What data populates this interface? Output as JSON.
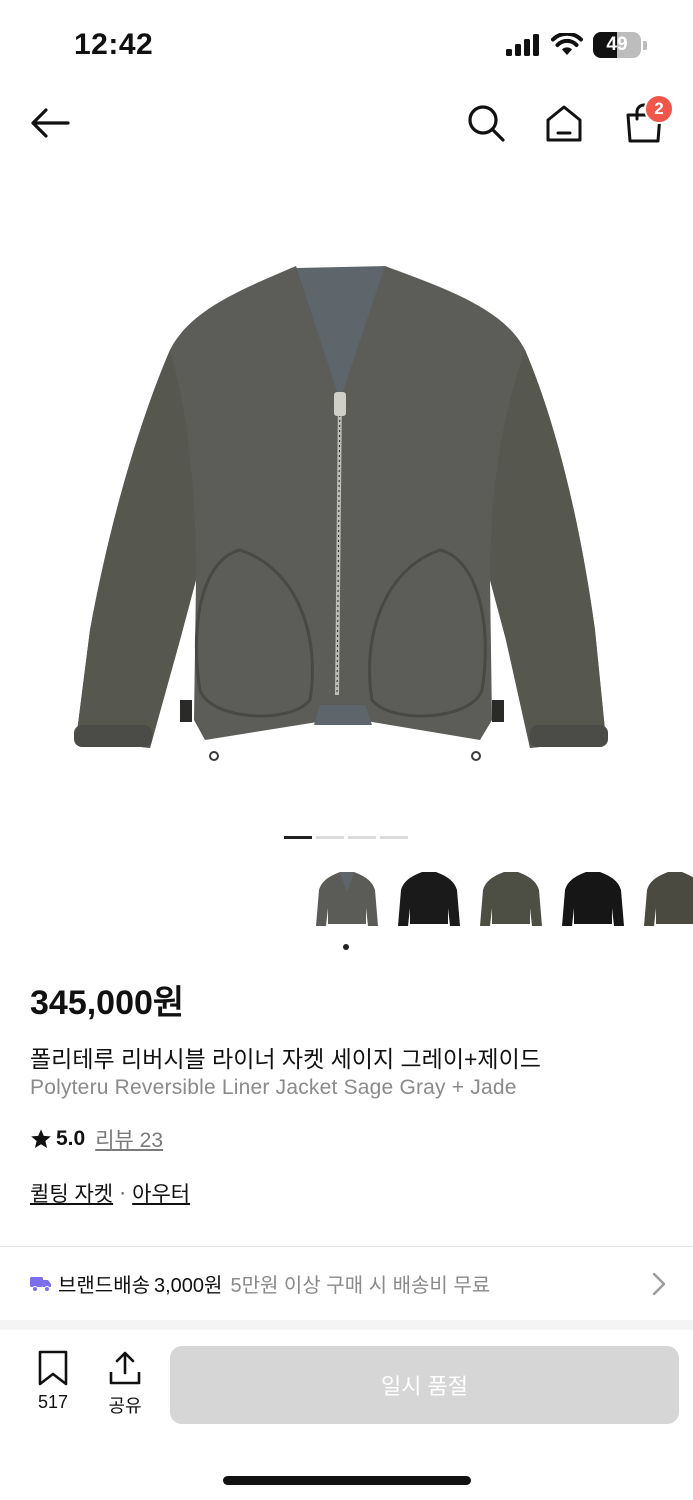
{
  "status_bar": {
    "time": "12:42",
    "battery_text": "49",
    "battery_level": 0.49,
    "icons": [
      "cellular-signal-icon",
      "wifi-icon",
      "battery-icon"
    ]
  },
  "nav": {
    "icons": [
      "back-arrow-icon",
      "search-icon",
      "home-icon",
      "shopping-bag-icon"
    ],
    "cart_count": "2"
  },
  "gallery": {
    "image_count": 4,
    "active_index": 0,
    "thumbnails": [
      {
        "color": "#5b5c58"
      },
      {
        "color": "#1a1a1a"
      },
      {
        "color": "#4e4f44"
      },
      {
        "color": "#161616"
      },
      {
        "color": "#4b4a40"
      }
    ],
    "selected_thumbnail": 0
  },
  "product": {
    "price": "345,000원",
    "title_ko": "폴리테루 리버시블 라이너 자켓 세이지 그레이+제이드",
    "title_en": "Polyteru Reversible Liner Jacket Sage Gray + Jade",
    "rating": "5.0",
    "review_label": "리뷰 23",
    "categories": [
      "퀼팅 자켓",
      "아우터"
    ],
    "category_separator": "·"
  },
  "shipping": {
    "label": "브랜드배송",
    "fee": "3,000원",
    "note": "5만원 이상 구매 시 배송비 무료"
  },
  "bottom_bar": {
    "bookmark_count": "517",
    "share_label": "공유",
    "soldout_label": "일시 품절"
  },
  "colors": {
    "badge": "#f0564a",
    "shipping_icon": "#7b6ff0",
    "disabled_button": "#d6d6d6"
  }
}
